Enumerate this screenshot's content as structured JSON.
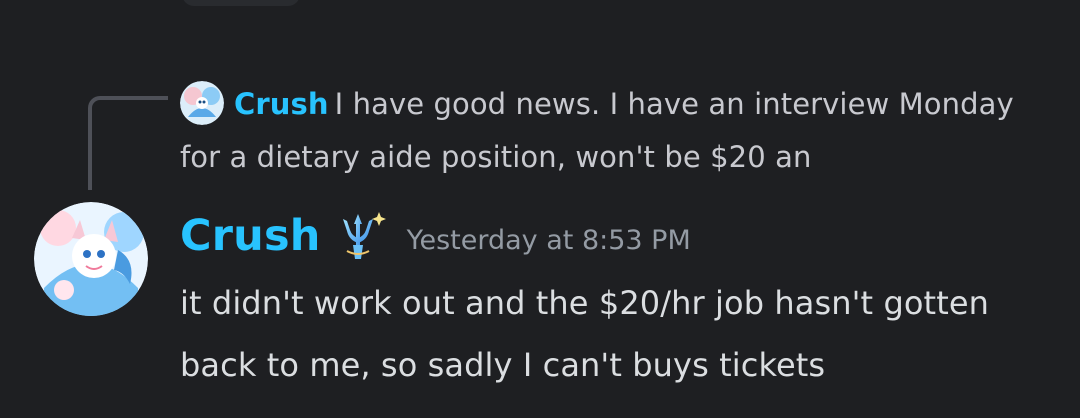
{
  "reply": {
    "author": "Crush",
    "snippet": "I have good news. I have an interview Monday for a dietary aide position, won't be $20 an"
  },
  "message": {
    "author": "Crush",
    "timestamp": "Yesterday at 8:53 PM",
    "text": "it didn't work out and the $20/hr job hasn't gotten back to me, so sadly I can't buys tickets",
    "role_icon": "trident-icon"
  },
  "colors": {
    "background": "#1e1f22",
    "author_name": "#28c3ff",
    "message_text": "#dbdee1",
    "reply_text": "#c8c9cf",
    "timestamp": "#949ba4",
    "reply_spine": "#4e5058"
  }
}
